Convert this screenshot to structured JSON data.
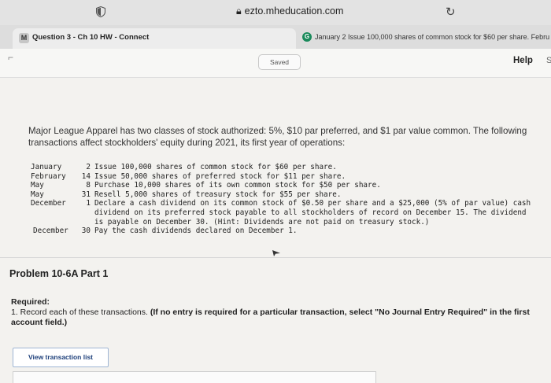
{
  "browser": {
    "url": "ezto.mheducation.com",
    "tabs": [
      {
        "favicon": "M",
        "title": "Question 3 - Ch 10 HW - Connect"
      },
      {
        "favicon": "G",
        "title": "January 2 Issue 100,000 shares of common stock for $60 per share. Febru"
      }
    ]
  },
  "header": {
    "saved": "Saved",
    "help": "Help",
    "help_extra": "S"
  },
  "problem": {
    "intro": "Major League Apparel has two classes of stock authorized: 5%, $10 par preferred, and $1 par value common. The following transactions affect stockholders' equity during 2021, its first year of operations:",
    "transactions": [
      {
        "month": "January",
        "day": "2",
        "desc": "Issue 100,000 shares of common stock for $60 per share."
      },
      {
        "month": "February",
        "day": "14",
        "desc": "Issue 50,000 shares of preferred stock for $11 per share."
      },
      {
        "month": "May",
        "day": "8",
        "desc": "Purchase 10,000 shares of its own common stock for $50 per share."
      },
      {
        "month": "May",
        "day": "31",
        "desc": "Resell 5,000 shares of treasury stock for $55 per share."
      },
      {
        "month": "December",
        "day": "1",
        "desc": "Declare a cash dividend on its common stock of $0.50 per share and a $25,000 (5% of par value) cash dividend on its preferred stock payable to all stockholders of record on December 15. The dividend is payable on December 30. (Hint: Dividends are not paid on treasury stock.)"
      },
      {
        "month": "December",
        "day": "30",
        "desc": "Pay the cash dividends declared on December 1."
      }
    ],
    "part_title": "Problem 10-6A Part 1",
    "required_label": "Required:",
    "required_text": "1. Record each of these transactions.",
    "required_bold": "(If no entry is required for a particular transaction, select \"No Journal Entry Required\" in the first account field.)",
    "view_button": "View transaction list"
  }
}
